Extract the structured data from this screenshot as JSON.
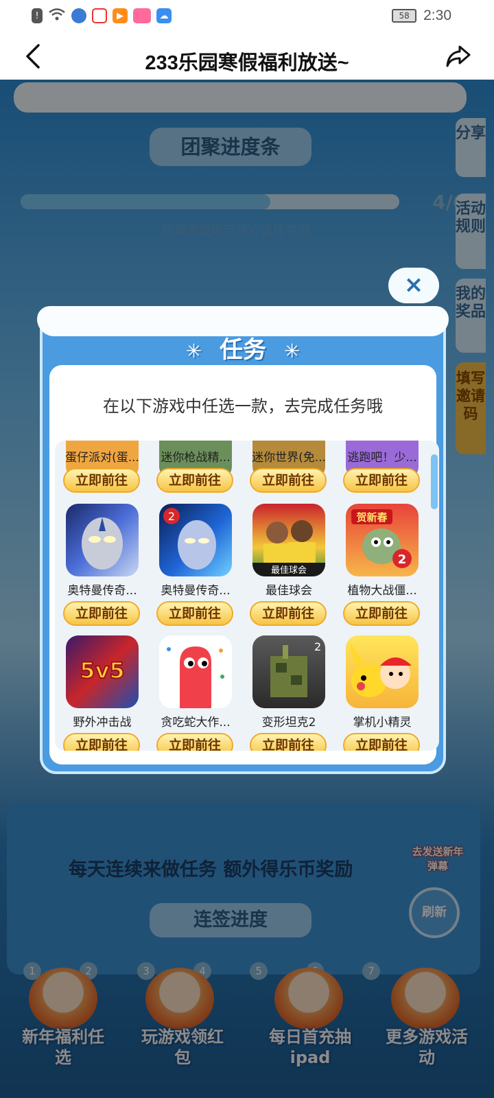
{
  "status_bar": {
    "time": "2:30",
    "battery": "58",
    "icons": [
      "alert-icon",
      "wifi-icon",
      "browser-icon",
      "weibo-icon",
      "video-icon",
      "bilibili-icon",
      "cloud-icon"
    ]
  },
  "header": {
    "title": "233乐园寒假福利放送~"
  },
  "background": {
    "progress_title": "团聚进度条",
    "progress_subtitle": "团聚完成即可随心选择奖励",
    "progress_count": "4/6",
    "progress_fraction": 0.66,
    "side_tabs": [
      "分享",
      "活动规则",
      "我的奖品",
      "填写邀请码"
    ],
    "banner_text": "每天连续来做任务 额外得乐币奖励",
    "checkin_title": "连签进度",
    "refresh_label": "刷新",
    "badge_text": "去发送新年弹幕",
    "steps": [
      "1",
      "2",
      "3",
      "4",
      "5",
      "6",
      "7"
    ],
    "nav": [
      {
        "label": "新年福利任选"
      },
      {
        "label": "玩游戏领红包"
      },
      {
        "label": "每日首充抽ipad"
      },
      {
        "label": "更多游戏活动"
      }
    ]
  },
  "modal": {
    "title": "任务",
    "instruction": "在以下游戏中任选一款，去完成任务哦",
    "close_label": "×",
    "button_label": "立即前往",
    "rows": [
      [
        {
          "name": "蛋仔派对(蛋...",
          "icon": "eggy-party-icon"
        },
        {
          "name": "迷你枪战精...",
          "icon": "mini-gun-icon"
        },
        {
          "name": "迷你世界(免...",
          "icon": "mini-world-icon"
        },
        {
          "name": "逃跑吧！少...",
          "icon": "escape-icon"
        }
      ],
      [
        {
          "name": "奥特曼传奇...",
          "icon": "ultraman-icon"
        },
        {
          "name": "奥特曼传奇...",
          "icon": "ultraman-2-icon"
        },
        {
          "name": "最佳球会",
          "icon": "football-club-icon"
        },
        {
          "name": "植物大战僵...",
          "icon": "pvz-icon"
        }
      ],
      [
        {
          "name": "野外冲击战",
          "icon": "5v5-icon"
        },
        {
          "name": "贪吃蛇大作...",
          "icon": "snake-icon"
        },
        {
          "name": "变形坦克2",
          "icon": "tank-icon"
        },
        {
          "name": "掌机小精灵",
          "icon": "pokemon-icon"
        }
      ]
    ],
    "icon_texts": {
      "pvz": "贺新春",
      "football": "最佳球会",
      "fivev5": "5v5"
    }
  },
  "colors": {
    "accent": "#4a9be0",
    "button": "#f7c444"
  }
}
